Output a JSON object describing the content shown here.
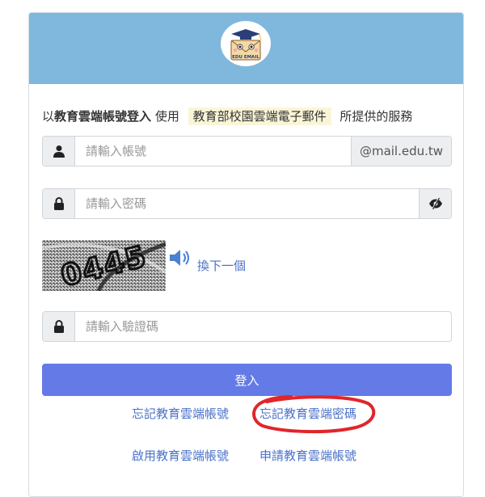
{
  "logo": {
    "text": "EDU EMAIL",
    "icon": "graduation-mascot-envelope"
  },
  "intro": {
    "prefix": "以",
    "bold": "教育雲端帳號登入",
    "middle": "使用",
    "highlight": "教育部校園雲端電子郵件",
    "suffix": "所提供的服務"
  },
  "account": {
    "placeholder": "請輸入帳號",
    "domain": "@mail.edu.tw",
    "icon": "user-icon"
  },
  "password": {
    "placeholder": "請輸入密碼",
    "icon": "lock-icon",
    "toggle_icon": "eye-slash-icon"
  },
  "captcha": {
    "text": "0445",
    "speaker_icon": "speaker-icon",
    "refresh_label": "換下一個"
  },
  "verify": {
    "placeholder": "請輸入驗證碼",
    "icon": "lock-icon"
  },
  "login_label": "登入",
  "links": {
    "forgot_account": "忘記教育雲端帳號",
    "forgot_password": "忘記教育雲端密碼",
    "activate_account": "啟用教育雲端帳號",
    "apply_account": "申請教育雲端帳號"
  },
  "colors": {
    "header": "#7fb8dc",
    "button": "#647ae6",
    "link": "#4a72c8",
    "highlight": "#fbf5d8",
    "annotation": "#e0262b"
  }
}
